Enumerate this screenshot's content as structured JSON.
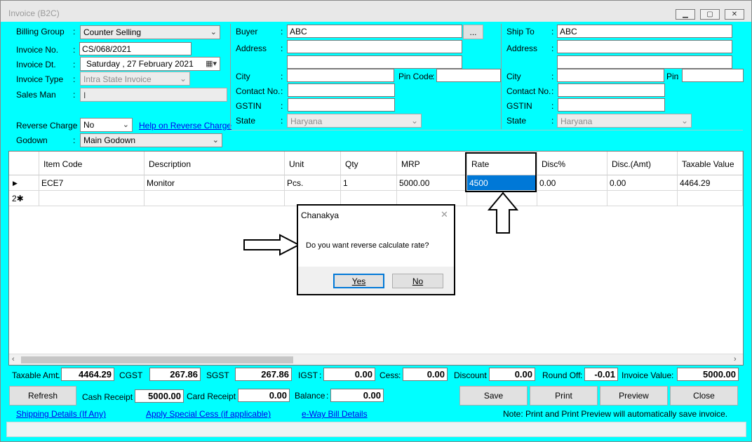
{
  "window": {
    "title": "Invoice (B2C)"
  },
  "billing": {
    "billing_group_label": "Billing Group",
    "billing_group_value": "Counter Selling",
    "invoice_no_label": "Invoice No.",
    "invoice_no_value": "CS/068/2021",
    "invoice_dt_label": "Invoice Dt.",
    "invoice_dt_value": "Saturday , 27 February  2021",
    "invoice_type_label": "Invoice Type",
    "invoice_type_value": "Intra State Invoice",
    "sales_man_label": "Sales Man",
    "sales_man_value": "I",
    "reverse_charge_label": "Reverse Charge",
    "reverse_charge_value": "No",
    "reverse_charge_help": "Help on Reverse Charge",
    "godown_label": "Godown",
    "godown_value": "Main Godown"
  },
  "buyer": {
    "buyer_label": "Buyer",
    "buyer_value": "ABC",
    "browse_label": "...",
    "address_label": "Address",
    "city_label": "City",
    "pin_label": "Pin Code",
    "contact_label": "Contact No.",
    "gstin_label": "GSTIN",
    "state_label": "State",
    "state_value": "Haryana"
  },
  "ship_to": {
    "ship_label": "Ship To",
    "ship_value": "ABC",
    "address_label": "Address",
    "city_label": "City",
    "pin_label": "Pin",
    "contact_label": "Contact No.",
    "gstin_label": "GSTIN",
    "state_label": "State",
    "state_value": "Haryana"
  },
  "grid": {
    "columns": [
      "Item Code",
      "Description",
      "Unit",
      "Qty",
      "MRP",
      "Rate",
      "Disc%",
      "Disc.(Amt)",
      "Taxable Value"
    ],
    "rows": [
      {
        "marker": "▶",
        "item_code": "ECE7",
        "description": "Monitor",
        "unit": "Pcs.",
        "qty": "1",
        "mrp": "5000.00",
        "rate": "4500",
        "disc_pct": "0.00",
        "disc_amt": "0.00",
        "taxable": "4464.29"
      }
    ],
    "new_row_marker": "2✱"
  },
  "dialog": {
    "title": "Chanakya",
    "message": "Do you want reverse calculate rate?",
    "yes_label": "Yes",
    "no_label": "No"
  },
  "totals": {
    "taxable_label": "Taxable Amt.",
    "taxable_value": "4464.29",
    "cgst_label": "CGST",
    "cgst_value": "267.86",
    "sgst_label": "SGST",
    "sgst_value": "267.86",
    "igst_label": "IGST",
    "igst_value": "0.00",
    "cess_label": "Cess",
    "cess_value": "0.00",
    "discount_label": "Discount",
    "discount_value": "0.00",
    "roundoff_label": "Round Off",
    "roundoff_value": "-0.01",
    "invoice_value_label": "Invoice Value",
    "invoice_value": "5000.00"
  },
  "payments": {
    "refresh_label": "Refresh",
    "cash_label": "Cash Receipt",
    "cash_value": "5000.00",
    "card_label": "Card Receipt",
    "card_value": "0.00",
    "balance_label": "Balance",
    "balance_value": "0.00"
  },
  "actions": {
    "save": "Save",
    "print": "Print",
    "preview": "Preview",
    "close": "Close"
  },
  "footer": {
    "shipping_link": "Shipping Details (If Any)",
    "cess_link": "Apply Special Cess (if applicable)",
    "eway_link": "e-Way Bill Details",
    "note": "Note: Print and Print Preview will automatically save invoice."
  },
  "colors": {
    "background": "#00ffff",
    "selected_cell": "#0078d7",
    "link": "#0000ee"
  }
}
